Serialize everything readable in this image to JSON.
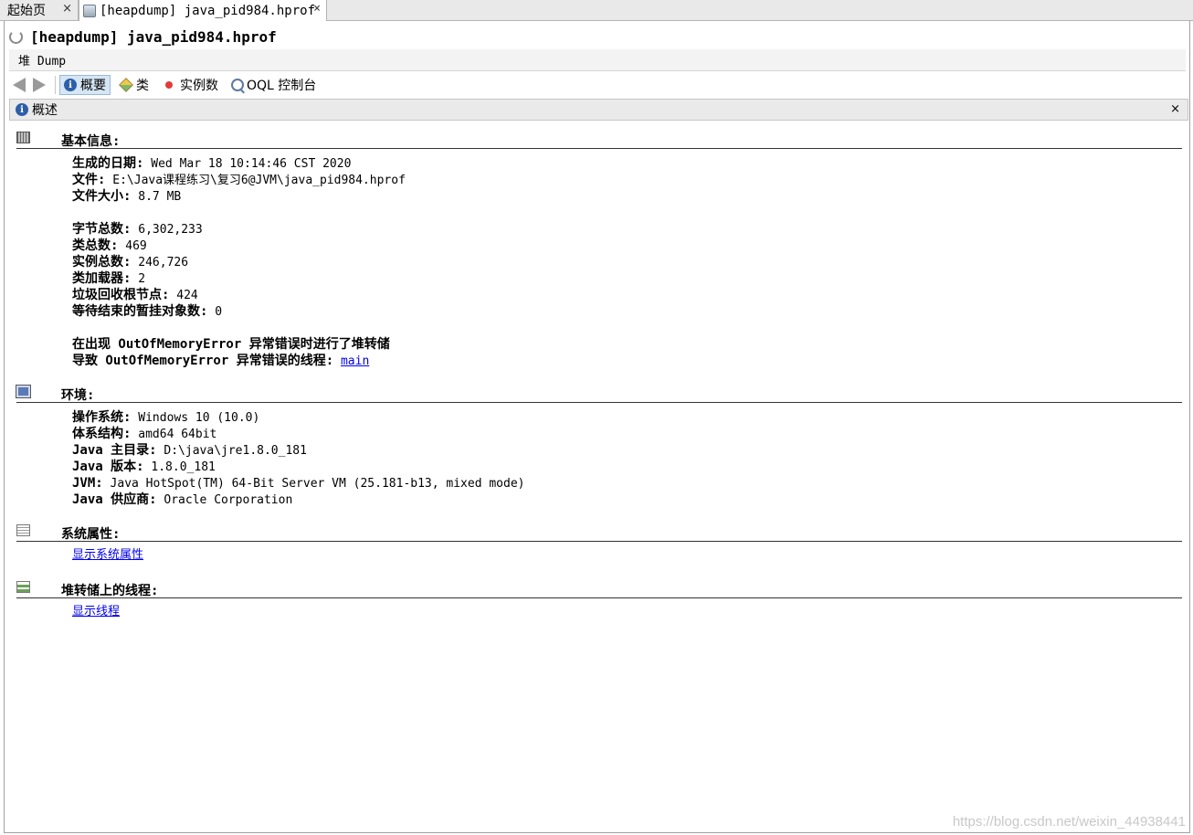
{
  "tabs": [
    {
      "label": "起始页",
      "close": "×"
    },
    {
      "label": "[heapdump] java_pid984.hprof",
      "close": "×"
    }
  ],
  "title": "[heapdump] java_pid984.hprof",
  "subbar": {
    "label": "堆 Dump"
  },
  "toolbar": {
    "summary": "概要",
    "classes": "类",
    "instances": "实例数",
    "oql": "OQL 控制台"
  },
  "panel": {
    "title": "概述",
    "close": "×"
  },
  "basic": {
    "heading": "基本信息:",
    "date_label": "生成的日期:",
    "date_value": "Wed Mar 18 10:14:46 CST 2020",
    "file_label": "文件:",
    "file_value": "E:\\Java课程练习\\复习6@JVM\\java_pid984.hprof",
    "size_label": "文件大小:",
    "size_value": "8.7 MB",
    "bytes_label": "字节总数:",
    "bytes_value": "6,302,233",
    "classes_label": "类总数:",
    "classes_value": "469",
    "instances_label": "实例总数:",
    "instances_value": "246,726",
    "loaders_label": "类加载器:",
    "loaders_value": "2",
    "gcroots_label": "垃圾回收根节点:",
    "gcroots_value": "424",
    "pending_label": "等待结束的暂挂对象数:",
    "pending_value": "0",
    "oom_line": "在出现 OutOfMemoryError 异常错误时进行了堆转储",
    "oom_thread_label": "导致 OutOfMemoryError 异常错误的线程:",
    "oom_thread_link": "main"
  },
  "env": {
    "heading": "环境:",
    "os_label": "操作系统:",
    "os_value": "Windows 10 (10.0)",
    "arch_label": "体系结构:",
    "arch_value": "amd64 64bit",
    "home_label": "Java 主目录:",
    "home_value": "D:\\java\\jre1.8.0_181",
    "version_label": "Java 版本:",
    "version_value": "1.8.0_181",
    "jvm_label": "JVM:",
    "jvm_value": "Java HotSpot(TM) 64-Bit Server VM (25.181-b13, mixed mode)",
    "vendor_label": "Java 供应商:",
    "vendor_value": "Oracle Corporation"
  },
  "sysprops": {
    "heading": "系统属性:",
    "link": "显示系统属性"
  },
  "threads": {
    "heading": "堆转储上的线程:",
    "link": "显示线程"
  },
  "watermark": "https://blog.csdn.net/weixin_44938441",
  "icons": {
    "tab_icon": "heapdump-icon",
    "title_icon": "loading-spinner-icon",
    "basic_icon": "chip-icon",
    "env_icon": "monitor-icon",
    "sysprops_icon": "document-icon",
    "threads_icon": "list-icon"
  }
}
